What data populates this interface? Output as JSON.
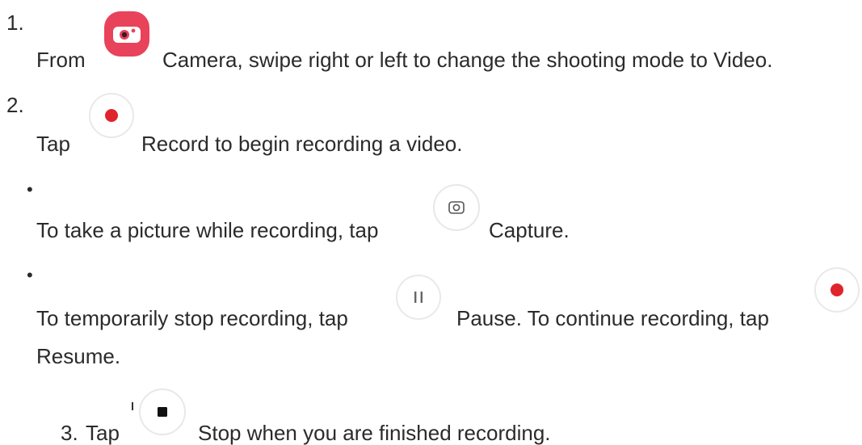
{
  "steps": [
    {
      "marker": "1.",
      "prefix": "From",
      "icon": "camera-app-icon",
      "label": "Camera",
      "text": ", swipe right or left to change the shooting mode to Video."
    },
    {
      "marker": "2.",
      "prefix": "Tap",
      "icon": "record-button-icon",
      "label": "Record",
      "text": " to begin recording a video."
    },
    {
      "marker": "3.",
      "prefix": "Tap",
      "icon": "stop-button-icon",
      "label": "Stop",
      "text": " when you are finished recording."
    }
  ],
  "bullets": [
    {
      "marker": "•",
      "prefix": "To take a picture while recording, tap",
      "icon": "capture-button-icon",
      "label": "Capture",
      "text": "."
    },
    {
      "marker": "•",
      "prefix": "To temporarily stop recording, tap",
      "icon": "pause-button-icon",
      "label": "Pause",
      "text": ". To continue recording, tap",
      "icon2": "resume-button-icon",
      "line2": "Resume."
    }
  ],
  "colors": {
    "text": "#2b2b2b",
    "camera_icon": "#e8435a",
    "record_dot": "#e0242c",
    "icon_border": "#e8e8e8",
    "icon_glyph": "#555555"
  }
}
